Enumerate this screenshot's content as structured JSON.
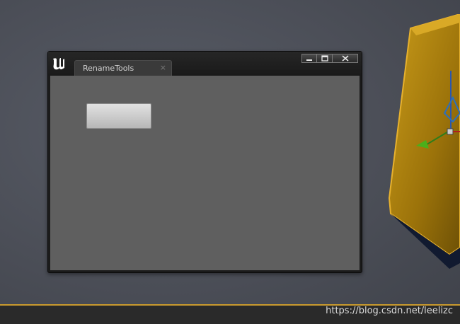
{
  "window": {
    "tab_title": "RenameTools",
    "tab_close_glyph": "×",
    "controls": [
      {
        "name": "minimize-icon"
      },
      {
        "name": "maximize-icon"
      },
      {
        "name": "close-icon"
      }
    ],
    "blank_button_label": ""
  },
  "app": {
    "logo": "unreal-engine-logo"
  },
  "watermark": "https://blog.csdn.net/leelizc",
  "colors": {
    "accent": "#c99a2e",
    "cube": "#b8890f",
    "content_bg": "#5f5f5f"
  }
}
